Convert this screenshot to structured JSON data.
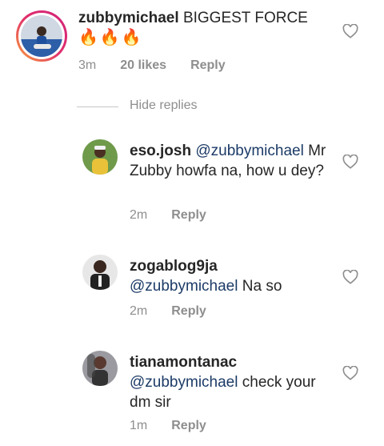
{
  "main_comment": {
    "username": "zubbymichael",
    "text": "BIGGEST FORCE",
    "emoji": "🔥🔥🔥",
    "time": "3m",
    "likes": "20 likes",
    "reply_label": "Reply"
  },
  "hide_replies_label": "Hide replies",
  "replies": [
    {
      "username": "eso.josh",
      "mention": "@zubbymichael",
      "text": "Mr Zubby howfa na, how u dey?",
      "time": "2m",
      "reply_label": "Reply"
    },
    {
      "username": "zogablog9ja",
      "mention": "@zubbymichael",
      "text": "Na so",
      "time": "2m",
      "reply_label": "Reply"
    },
    {
      "username": "tianamontanac",
      "mention": "@zubbymichael",
      "text": "check your dm sir",
      "time": "1m",
      "reply_label": "Reply"
    }
  ],
  "colors": {
    "mention": "#1c3b67",
    "meta": "#8e8e8e",
    "story_ring_start": "#f9a23a",
    "story_ring_end": "#d1237a"
  },
  "icons": {
    "like": "heart-outline-icon"
  }
}
